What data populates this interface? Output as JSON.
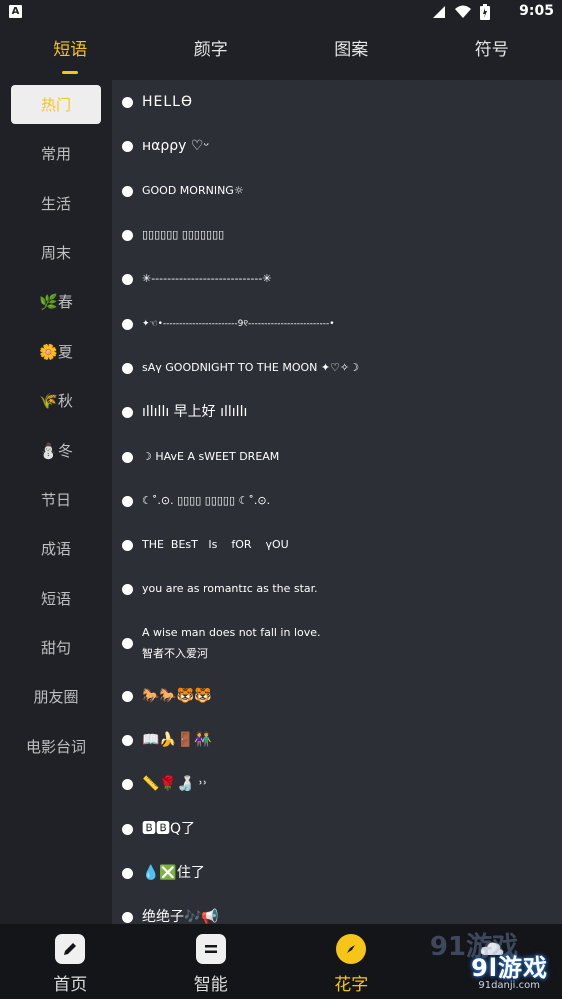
{
  "status_bar": {
    "badge": "A",
    "time": "9:05"
  },
  "top_tabs": [
    {
      "label": "短语",
      "active": true
    },
    {
      "label": "颜字",
      "active": false
    },
    {
      "label": "图案",
      "active": false
    },
    {
      "label": "符号",
      "active": false
    }
  ],
  "sidebar": [
    {
      "label": "热门",
      "active": true
    },
    {
      "label": "常用"
    },
    {
      "label": "生活"
    },
    {
      "label": "周末"
    },
    {
      "label": "🌿春"
    },
    {
      "label": "🌼夏"
    },
    {
      "label": "🌾秋"
    },
    {
      "label": "⛄冬"
    },
    {
      "label": "节日"
    },
    {
      "label": "成语"
    },
    {
      "label": "短语"
    },
    {
      "label": "甜句"
    },
    {
      "label": "朋友圈"
    },
    {
      "label": "电影台词"
    }
  ],
  "phrases": [
    "HELLϴ",
    "нαρρу ♡ᵕ",
    "GOOD MORNING☼",
    "▯▯▯▯▯▯ ▯▯▯▯▯▯▯",
    "✳----------------------------✳",
    "✦☜•-----------------------9୧-------------------------•",
    "sAү GOODNIGHT TO THE MOON ✦♡✧☽",
    "ıllıllı 早上好 ıllıllı",
    "☽ HAvE A sWEET DREAM",
    "☾˚.⊙. ▯▯▯▯ ▯▯▯▯▯ ☾˚.⊙.",
    "THE  BEsT   Is    fOR    үOU",
    "you are as romantɪc as the star.",
    "A wise man does not fall in love.\n智者不入爱河",
    "🐎🐎🐯🐯",
    "📖🍌🚪👫",
    "📏🌹🍶 ˒˒",
    "🅱🅱Q了",
    "💧❎住了",
    "绝绝子🎶📢"
  ],
  "bottom_nav": [
    {
      "label": "首页",
      "icon": "pencil-icon"
    },
    {
      "label": "智能",
      "icon": "menu-icon"
    },
    {
      "label": "花字",
      "icon": "compass-icon",
      "active": true
    },
    {
      "label": "",
      "icon": "cloud-icon"
    }
  ],
  "watermark": {
    "ghost": "91游戏",
    "brand": "9l游戏",
    "domain": "91danji.com"
  },
  "colors": {
    "accent": "#f5c518",
    "background": "#1f2126",
    "list_background": "#2c2f35",
    "nav_background": "#141518"
  }
}
